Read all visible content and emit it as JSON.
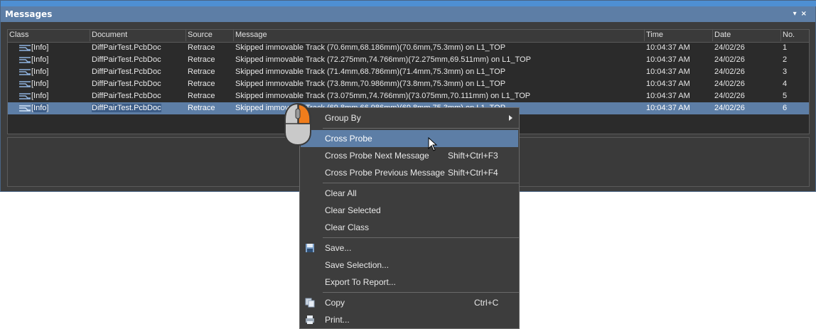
{
  "panel": {
    "title": "Messages",
    "pin_label": "▾",
    "close_label": "×"
  },
  "columns": [
    "Class",
    "Document",
    "Source",
    "Message",
    "Time",
    "Date",
    "No."
  ],
  "rows": [
    {
      "class": "[Info]",
      "document": "DiffPairTest.PcbDoc",
      "source": "Retrace",
      "message": "Skipped immovable Track (70.6mm,68.186mm)(70.6mm,75.3mm) on L1_TOP",
      "time": "10:04:37 AM",
      "date": "24/02/26",
      "no": "1"
    },
    {
      "class": "[Info]",
      "document": "DiffPairTest.PcbDoc",
      "source": "Retrace",
      "message": "Skipped immovable Track (72.275mm,74.766mm)(72.275mm,69.511mm) on L1_TOP",
      "time": "10:04:37 AM",
      "date": "24/02/26",
      "no": "2"
    },
    {
      "class": "[Info]",
      "document": "DiffPairTest.PcbDoc",
      "source": "Retrace",
      "message": "Skipped immovable Track (71.4mm,68.786mm)(71.4mm,75.3mm) on L1_TOP",
      "time": "10:04:37 AM",
      "date": "24/02/26",
      "no": "3"
    },
    {
      "class": "[Info]",
      "document": "DiffPairTest.PcbDoc",
      "source": "Retrace",
      "message": "Skipped immovable Track (73.8mm,70.986mm)(73.8mm,75.3mm) on L1_TOP",
      "time": "10:04:37 AM",
      "date": "24/02/26",
      "no": "4"
    },
    {
      "class": "[Info]",
      "document": "DiffPairTest.PcbDoc",
      "source": "Retrace",
      "message": "Skipped immovable Track (73.075mm,74.766mm)(73.075mm,70.111mm) on L1_TOP",
      "time": "10:04:37 AM",
      "date": "24/02/26",
      "no": "5"
    },
    {
      "class": "[Info]",
      "document": "DiffPairTest.PcbDoc",
      "source": "Retrace",
      "message": "Skipped immovable Track (69.8mm,66.986mm)(69.8mm,75.3mm) on L1_TOP",
      "time": "10:04:37 AM",
      "date": "24/02/26",
      "no": "6"
    }
  ],
  "context_menu": {
    "group_by": "Group By",
    "cross_probe": "Cross Probe",
    "cross_probe_next": "Cross Probe Next Message",
    "cross_probe_next_sc": "Shift+Ctrl+F3",
    "cross_probe_prev": "Cross Probe Previous Message",
    "cross_probe_prev_sc": "Shift+Ctrl+F4",
    "clear_all": "Clear All",
    "clear_selected": "Clear Selected",
    "clear_class": "Clear Class",
    "save": "Save...",
    "save_selection": "Save Selection...",
    "export_report": "Export To Report...",
    "copy": "Copy",
    "copy_sc": "Ctrl+C",
    "print": "Print..."
  },
  "colors": {
    "accent": "#5d7ea6",
    "mouse_button": "#f07d1c"
  }
}
